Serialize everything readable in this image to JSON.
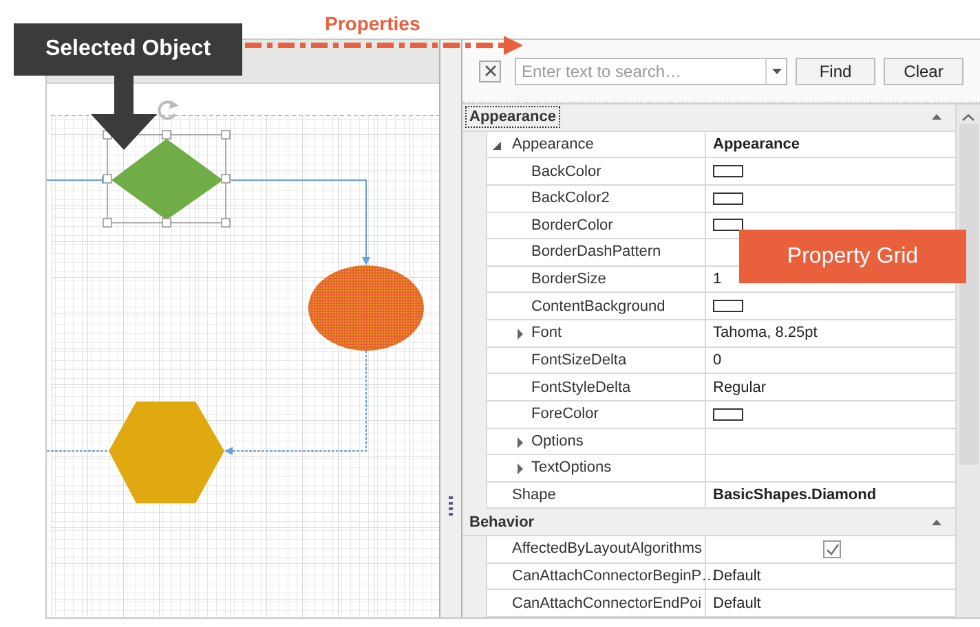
{
  "selected_callout": "Selected Object",
  "properties_label": "Properties",
  "grid_callout": "Property Grid",
  "search": {
    "placeholder": "Enter text to search…"
  },
  "buttons": [
    "Find",
    "Clear"
  ],
  "categories": [
    {
      "name": "Appearance",
      "expanded": true,
      "focused": true,
      "rows": [
        {
          "name": "Appearance",
          "kind": "bold",
          "value": "Appearance",
          "expanded": true,
          "children": [
            {
              "name": "BackColor",
              "kind": "color"
            },
            {
              "name": "BackColor2",
              "kind": "color"
            },
            {
              "name": "BorderColor",
              "kind": "color"
            },
            {
              "name": "BorderDashPattern",
              "kind": "empty"
            },
            {
              "name": "BorderSize",
              "kind": "text",
              "value": "1"
            },
            {
              "name": "ContentBackground",
              "kind": "color"
            },
            {
              "name": "Font",
              "kind": "text",
              "value": "Tahoma, 8.25pt",
              "expanded": false
            },
            {
              "name": "FontSizeDelta",
              "kind": "text",
              "value": "0"
            },
            {
              "name": "FontStyleDelta",
              "kind": "text",
              "value": "Regular"
            },
            {
              "name": "ForeColor",
              "kind": "color"
            },
            {
              "name": "Options",
              "kind": "empty",
              "expanded": false
            },
            {
              "name": "TextOptions",
              "kind": "empty",
              "expanded": false
            }
          ]
        },
        {
          "name": "Shape",
          "kind": "bold",
          "value": "BasicShapes.Diamond"
        }
      ]
    },
    {
      "name": "Behavior",
      "expanded": true,
      "focused": false,
      "rows": [
        {
          "name": "AffectedByLayoutAlgorithms",
          "kind": "check",
          "checked": true
        },
        {
          "name": "CanAttachConnectorBeginP…",
          "kind": "text",
          "value": "Default"
        },
        {
          "name": "CanAttachConnectorEndPoi",
          "kind": "text",
          "value": "Default"
        }
      ]
    }
  ]
}
